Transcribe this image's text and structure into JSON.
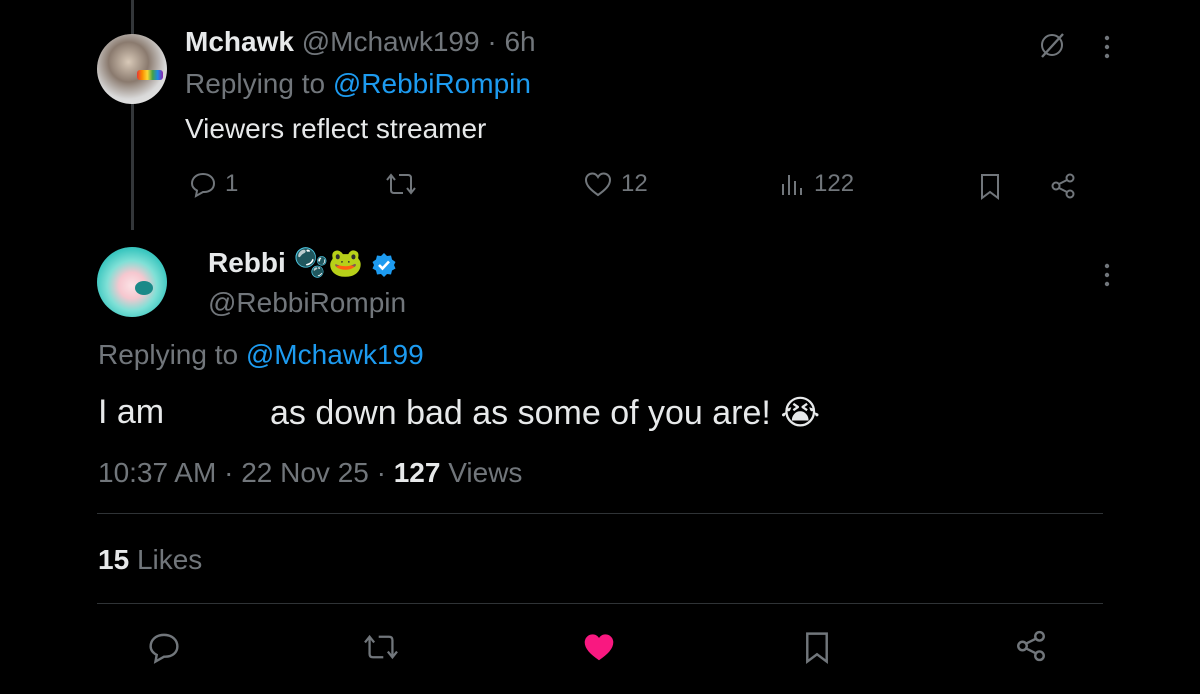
{
  "reply_tweet": {
    "display_name": "Mchawk",
    "handle": "@Mchawk199",
    "separator": "·",
    "time_ago": "6h",
    "replying_prefix": "Replying to",
    "replying_to": "@RebbiRompin",
    "text": "Viewers reflect streamer",
    "actions": {
      "replies": "1",
      "retweets": "",
      "likes": "12",
      "views": "122"
    },
    "icons": [
      "grok-icon",
      "more-icon",
      "reply-icon",
      "retweet-icon",
      "like-icon",
      "views-icon",
      "bookmark-icon",
      "share-icon"
    ]
  },
  "main_tweet": {
    "display_name": "Rebbi",
    "name_emojis": "🫧🐸",
    "handle": "@RebbiRompin",
    "replying_prefix": "Replying to",
    "replying_to": "@Mchawk199",
    "text_part1": "I am",
    "text_part2": "as down bad as some of you are!",
    "text_emoji": "😭",
    "time": "10:37 AM",
    "sep1": "·",
    "date": "22 Nov 25",
    "sep2": "·",
    "views_count": "127",
    "views_label": "Views",
    "likes_count": "15",
    "likes_label": "Likes"
  },
  "colors": {
    "background": "#000000",
    "text": "#e7e9ea",
    "muted": "#71767b",
    "link": "#1d9bf0",
    "like_active": "#f91880",
    "divider": "#2f3336"
  }
}
